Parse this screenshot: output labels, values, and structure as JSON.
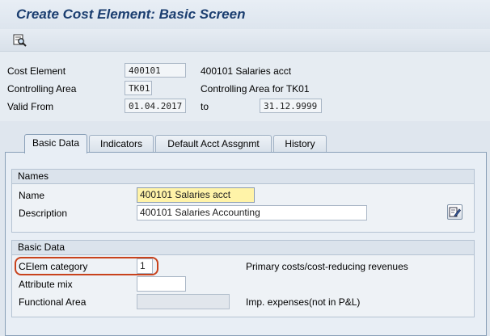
{
  "screen": {
    "title": "Create Cost Element: Basic Screen"
  },
  "toolbar": {
    "icons": [
      "display-change-icon"
    ]
  },
  "header": {
    "cost_element": {
      "label": "Cost Element",
      "value": "400101",
      "text": "400101 Salaries acct"
    },
    "controlling_area": {
      "label": "Controlling Area",
      "value": "TK01",
      "text": "Controlling Area for TK01"
    },
    "valid_from": {
      "label": "Valid From",
      "value": "01.04.2017",
      "to_label": "to",
      "to_value": "31.12.9999"
    }
  },
  "tabs": [
    {
      "label": "Basic Data",
      "active": true
    },
    {
      "label": "Indicators",
      "active": false
    },
    {
      "label": "Default Acct Assgnmt",
      "active": false
    },
    {
      "label": "History",
      "active": false
    }
  ],
  "names_group": {
    "title": "Names",
    "name": {
      "label": "Name",
      "value": "400101 Salaries acct"
    },
    "description": {
      "label": "Description",
      "value": "400101 Salaries Accounting"
    }
  },
  "basic_data_group": {
    "title": "Basic Data",
    "celem_category": {
      "label": "CElem category",
      "value": "1",
      "text": "Primary costs/cost-reducing revenues"
    },
    "attribute_mix": {
      "label": "Attribute mix",
      "value": ""
    },
    "functional_area": {
      "label": "Functional Area",
      "value": "",
      "text": "Imp. expenses(not in P&L)"
    }
  },
  "colors": {
    "title": "#1b3e70",
    "active_field": "#fff3a8",
    "highlight": "#c8421c"
  }
}
